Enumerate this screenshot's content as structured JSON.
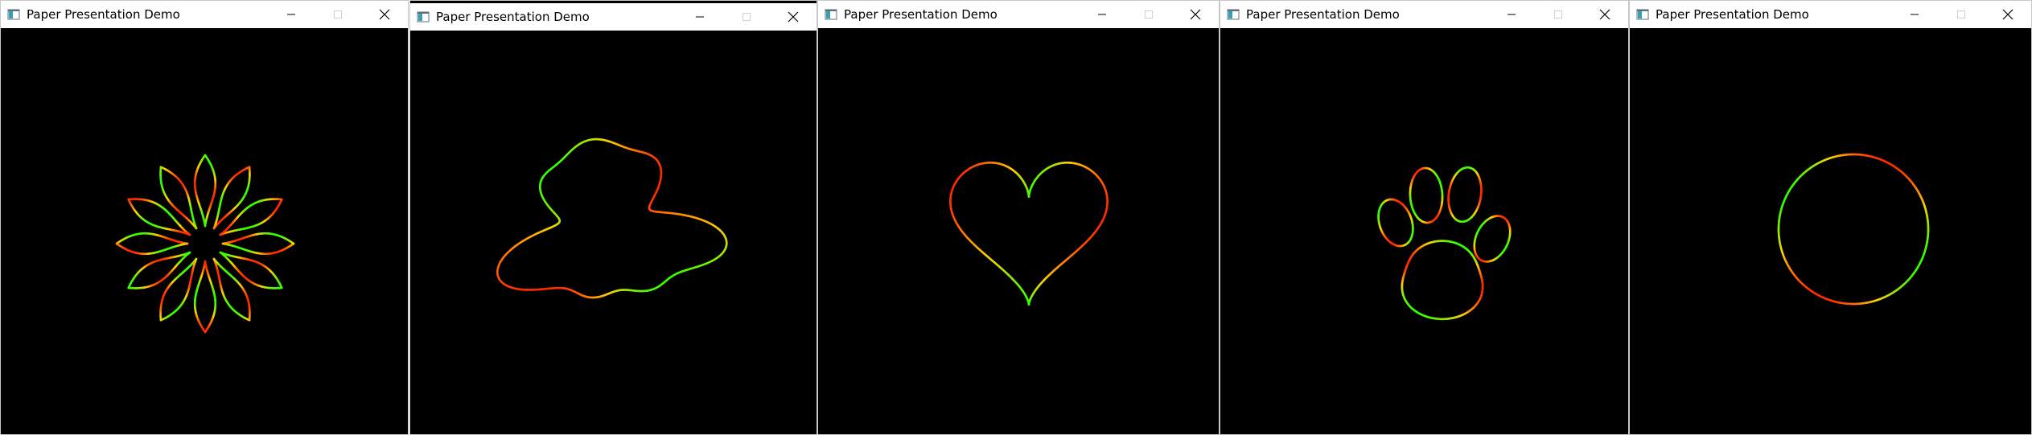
{
  "windows": [
    {
      "id": "w1",
      "title": "Paper Presentation Demo",
      "shape": "flower"
    },
    {
      "id": "w2",
      "title": "Paper Presentation Demo",
      "shape": "blob"
    },
    {
      "id": "w3",
      "title": "Paper Presentation Demo",
      "shape": "heart"
    },
    {
      "id": "w4",
      "title": "Paper Presentation Demo",
      "shape": "paw"
    },
    {
      "id": "w5",
      "title": "Paper Presentation Demo",
      "shape": "circle"
    }
  ],
  "icons": {
    "app": "app-window-icon",
    "minimize": "minimize-icon",
    "maximize": "maximize-icon",
    "close": "close-icon"
  },
  "colors": {
    "stroke_start": "#ff2a00",
    "stroke_mid": "#ffd000",
    "stroke_end": "#33ff00",
    "canvas_bg": "#000000"
  }
}
